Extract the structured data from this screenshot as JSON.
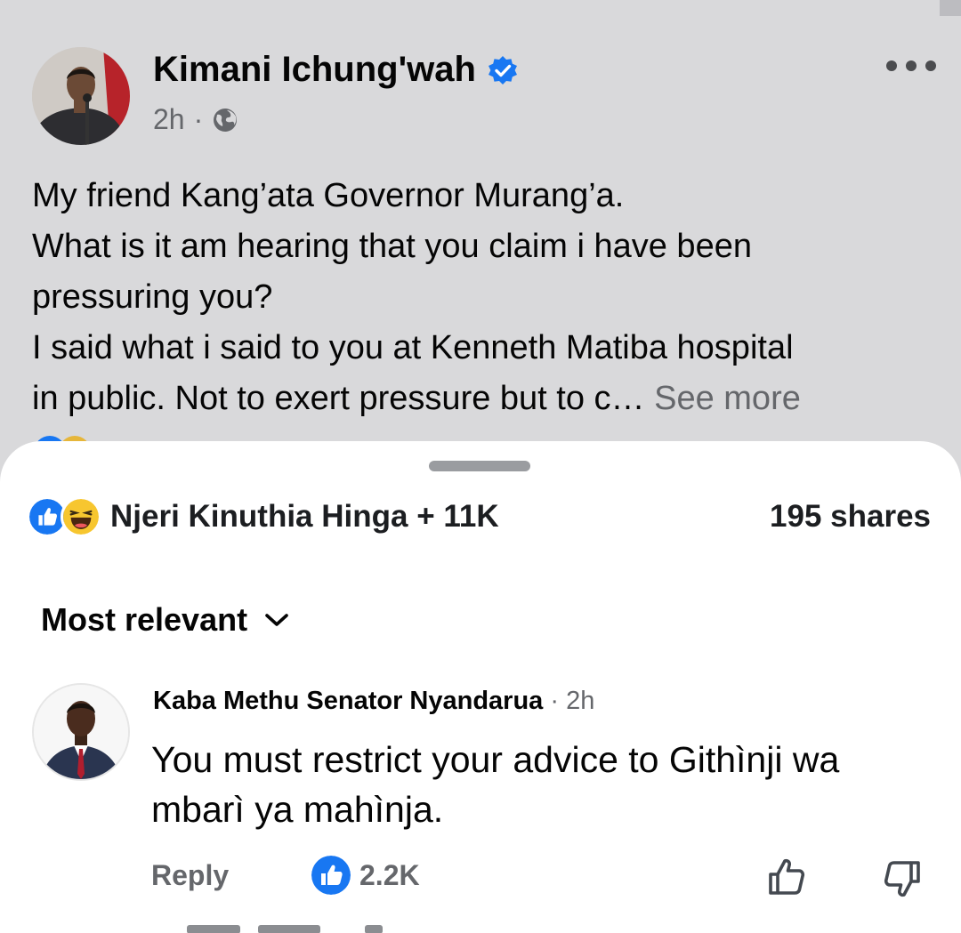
{
  "post": {
    "author": "Kimani Ichung'wah",
    "time": "2h",
    "text_lines": [
      "My friend Kang’ata Governor Murang’a.",
      "What is it am hearing that you claim i have been",
      "pressuring you?",
      "I said what i said to you at Kenneth Matiba hospital",
      "in public. Not to exert pressure but to c…"
    ],
    "see_more": "See more"
  },
  "sheet": {
    "reactions_text": "Njeri Kinuthia Hinga + 11K",
    "shares": "195 shares",
    "sort_label": "Most relevant"
  },
  "comment": {
    "author": "Kaba Methu Senator Nyandarua",
    "time": "· 2h",
    "text_line1": "You must restrict your advice to Githìnji wa",
    "text_line2": "mbarì ya mahìnja.",
    "reply_label": "Reply",
    "like_count": "2.2K"
  },
  "colors": {
    "facebook_blue": "#1877f2",
    "secondary_text": "#65676b",
    "haha_yellow": "#f7c62f"
  },
  "icons": [
    "verified-badge-icon",
    "globe-icon",
    "more-options-icon",
    "like-reaction-icon",
    "haha-reaction-icon",
    "chevron-down-icon",
    "thumbs-up-icon",
    "thumbs-down-icon"
  ]
}
